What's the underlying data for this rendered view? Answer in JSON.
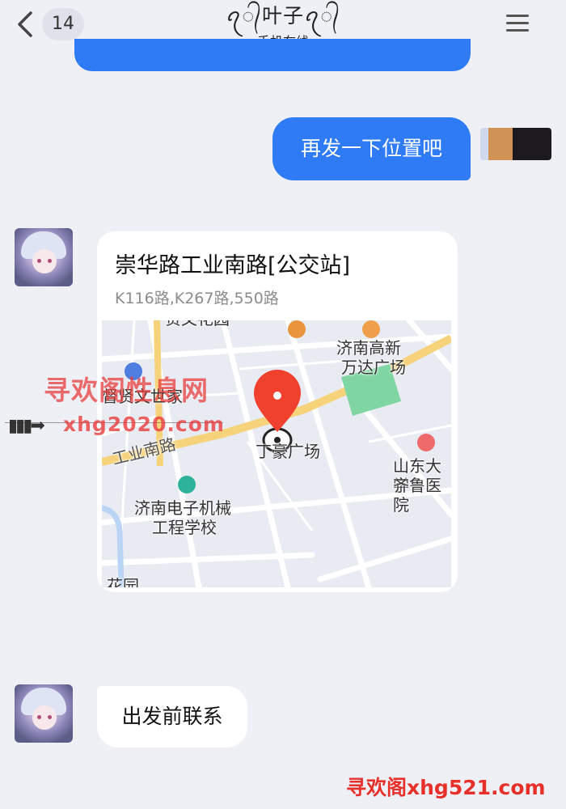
{
  "header": {
    "back_icon": "chevron-left-icon",
    "unread_count": "14",
    "contact_name": "ꪖ᭄叶子ꪖ᭄",
    "status": "手机在线",
    "menu_icon": "hamburger-menu-icon"
  },
  "messages": {
    "outgoing_text": "再发一下位置吧",
    "location": {
      "title": "崇华路工业南路[公交站]",
      "subtitle": "K116路,K267路,550路",
      "map_labels": {
        "top_poi": "贤文花园",
        "wanda_line1": "济南高新",
        "wanda_line2": "万达广场",
        "xianwen": "督贤文世家",
        "road": "工业南路",
        "dingxiang": "丁豪广场",
        "shandong_line1": "山东大学",
        "shandong_line2": "齐鲁医院",
        "school_line1": "济南电子机械",
        "school_line2": "工程学校",
        "bottom_poi": "花园"
      }
    },
    "incoming_text": "出发前联系"
  },
  "watermarks": {
    "site_cn": "寻欢阁性息网",
    "site_url": "xhg2020.com",
    "footer": "寻欢阁xhg521.com"
  },
  "colors": {
    "bubble_blue": "#2f7bf6",
    "background": "#eef0f6",
    "pin_red": "#f0412e"
  }
}
